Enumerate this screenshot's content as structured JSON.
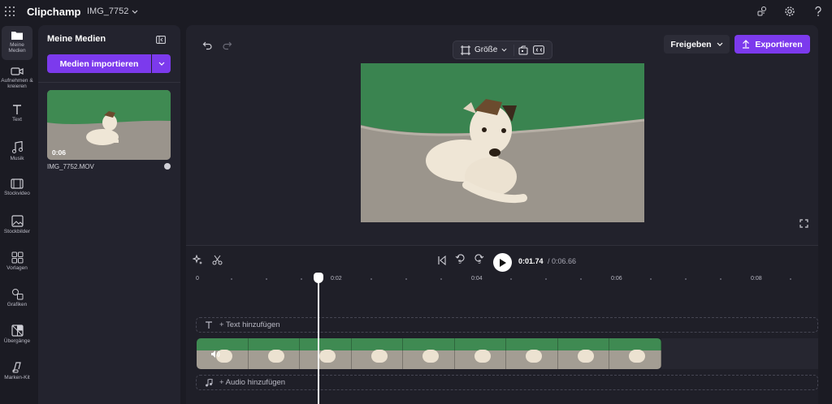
{
  "app": {
    "title": "Clipchamp",
    "project_name": "IMG_7752"
  },
  "top_icons": [
    "collab-icon",
    "gear-icon",
    "help-icon"
  ],
  "nav": [
    {
      "label": "Meine Medien",
      "icon": "folder-icon",
      "active": true
    },
    {
      "label": "Aufnehmen & kreieren",
      "icon": "camera-icon"
    },
    {
      "label": "Text",
      "icon": "text-icon"
    },
    {
      "label": "Musik",
      "icon": "music-icon"
    },
    {
      "label": "Stockvideo",
      "icon": "film-icon"
    },
    {
      "label": "Stockbilder",
      "icon": "image-icon"
    },
    {
      "label": "Vorlagen",
      "icon": "templates-icon"
    },
    {
      "label": "Grafiken",
      "icon": "shapes-icon"
    },
    {
      "label": "Übergänge",
      "icon": "transitions-icon"
    },
    {
      "label": "Marken-Kit",
      "icon": "brand-icon"
    }
  ],
  "media_panel": {
    "title": "Meine Medien",
    "import_label": "Medien importieren",
    "item": {
      "duration": "0:06",
      "filename": "IMG_7752.MOV"
    }
  },
  "preview": {
    "size_label": "Größe",
    "share_label": "Freigeben",
    "export_label": "Exportieren"
  },
  "playback": {
    "current": "0:01.74",
    "total": "/ 0:06.66",
    "rewind_seconds": "5",
    "forward_seconds": "5"
  },
  "ruler": [
    "0",
    "0:02",
    "0:04",
    "0:06",
    "0:08"
  ],
  "tracks": {
    "text_add": "+ Text hinzufügen",
    "audio_add": "+ Audio hinzufügen"
  },
  "colors": {
    "accent": "#7c3aed",
    "background": "#1b1b23",
    "panel": "#23232e"
  }
}
